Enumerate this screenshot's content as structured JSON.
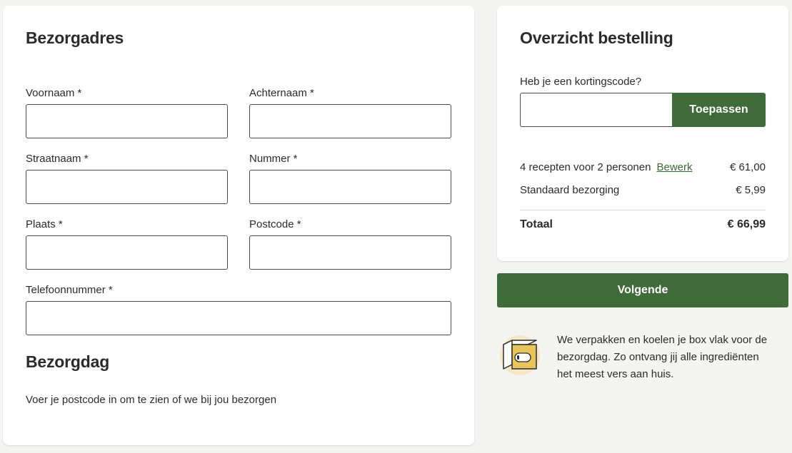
{
  "address": {
    "title": "Bezorgadres",
    "fields": {
      "first_name": {
        "label": "Voornaam *",
        "value": ""
      },
      "last_name": {
        "label": "Achternaam *",
        "value": ""
      },
      "street": {
        "label": "Straatnaam *",
        "value": ""
      },
      "number": {
        "label": "Nummer *",
        "value": ""
      },
      "city": {
        "label": "Plaats *",
        "value": ""
      },
      "postcode": {
        "label": "Postcode *",
        "value": ""
      },
      "phone": {
        "label": "Telefoonnummer *",
        "value": ""
      }
    }
  },
  "delivery_day": {
    "title": "Bezorgdag",
    "hint": "Voer je postcode in om te zien of we bij jou bezorgen"
  },
  "order_summary": {
    "title": "Overzicht bestelling",
    "coupon_label": "Heb je een kortingscode?",
    "coupon_value": "",
    "apply_label": "Toepassen",
    "lines": [
      {
        "label": "4 recepten voor 2 personen",
        "link": "Bewerk",
        "price": "€ 61,00"
      },
      {
        "label": "Standaard bezorging",
        "price": "€ 5,99"
      }
    ],
    "total_label": "Totaal",
    "total_price": "€ 66,99"
  },
  "next_label": "Volgende",
  "info": {
    "icon": "box-icon",
    "text": "We verpakken en koelen je box vlak voor de bezorgdag. Zo ontvang jij alle ingrediënten het meest vers aan huis."
  },
  "colors": {
    "accent": "#3f6a3a",
    "background": "#f4f4f3",
    "icon_bg": "#f7e6c6",
    "icon_box": "#e8c55a"
  }
}
